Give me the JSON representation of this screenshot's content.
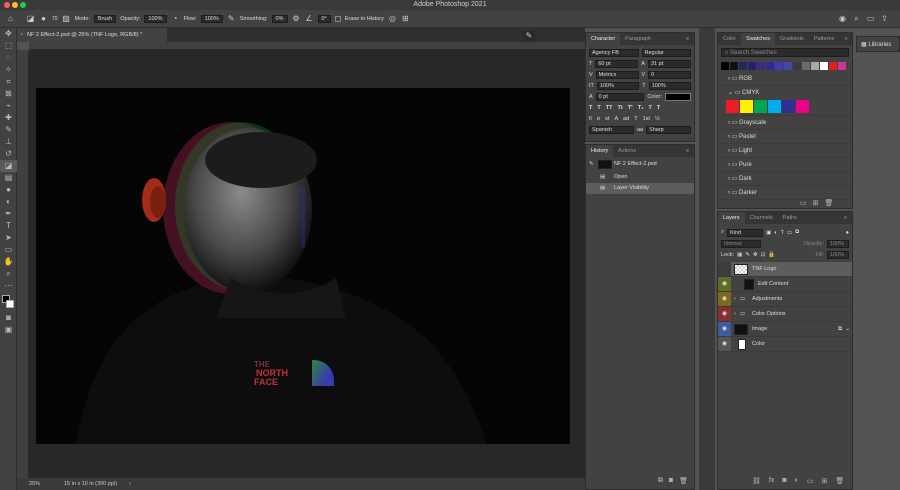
{
  "app": {
    "title": "Adobe Photoshop 2021"
  },
  "options_bar": {
    "brush_size": "70",
    "mode_label": "Mode:",
    "mode_value": "Brush",
    "opacity_label": "Opacity:",
    "opacity_value": "100%",
    "flow_label": "Flow:",
    "flow_value": "100%",
    "smoothing_label": "Smoothing:",
    "smoothing_value": "0%",
    "angle_value": "0°",
    "erase_history_label": "Erase to History"
  },
  "document": {
    "tab_title": "NF 2 Effect-2.psd @ 25% (TNF Logo, RGB/8) *",
    "zoom": "25%",
    "doc_size": "15 in x 10 in (300 ppi)",
    "logo_text": [
      "THE",
      "NORTH",
      "FACE"
    ]
  },
  "character_panel": {
    "tabs": [
      "Character",
      "Paragraph"
    ],
    "font_family": "Agency FB",
    "font_style": "Regular",
    "font_size": "60 pt",
    "leading": "31 pt",
    "kerning": "Metrics",
    "tracking": "0",
    "vscale": "100%",
    "hscale": "100%",
    "baseline": "0 pt",
    "color_label": "Color:",
    "language": "Spanish",
    "antialias": "Sharp",
    "style_buttons": [
      "T",
      "T",
      "TT",
      "Tt",
      "T¹",
      "T₁",
      "T",
      "T"
    ],
    "ligature_buttons": [
      "fi",
      "σ",
      "st",
      "A",
      "ad",
      "T",
      "1st",
      "½"
    ]
  },
  "history_panel": {
    "tabs": [
      "History",
      "Actions"
    ],
    "snapshot": "NF 2 Effect-2.psd",
    "steps": [
      "Open",
      "Layer Visibility"
    ]
  },
  "swatches_panel": {
    "tabs": [
      "Color",
      "Swatches",
      "Gradients",
      "Patterns"
    ],
    "search_placeholder": "Search Swatches",
    "recent_colors": [
      "#000000",
      "#111111",
      "#1d2a5a",
      "#24206a",
      "#3a2d7a",
      "#302a9c",
      "#3c3cb4",
      "#4646aa",
      "#3a3a3a",
      "#6a6a6a",
      "#a8a8a8",
      "#ffffff",
      "#e02020",
      "#cc3399"
    ],
    "groups": [
      "RGB",
      "CMYK",
      "Grayscale",
      "Pastel",
      "Light",
      "Pure",
      "Dark",
      "Darker"
    ],
    "cmyk_colors": [
      "#ee1c24",
      "#fff200",
      "#00a651",
      "#00aeef",
      "#2e3192",
      "#ec008c"
    ]
  },
  "layers_panel": {
    "tabs": [
      "Layers",
      "Channels",
      "Paths"
    ],
    "filter_kind": "Kind",
    "blend_mode": "Normal",
    "opacity_label": "Opacity:",
    "opacity_value": "100%",
    "lock_label": "Lock:",
    "fill_label": "Fill:",
    "fill_value": "100%",
    "layers": [
      {
        "name": "TNF Logo",
        "visible": false,
        "color": "#555555"
      },
      {
        "name": "Edit Content",
        "visible": true,
        "color": "#5a6e2a"
      },
      {
        "name": "Adjustments",
        "visible": true,
        "color": "#7a6a1a"
      },
      {
        "name": "Color Options",
        "visible": true,
        "color": "#8a2f2f"
      },
      {
        "name": "Image",
        "visible": true,
        "color": "#3b5d9e"
      },
      {
        "name": "Color",
        "visible": true,
        "color": "#555555"
      }
    ]
  },
  "libraries": {
    "label": "Libraries"
  },
  "colors": {
    "ui_dark": "#424242",
    "panel_header": "#353535",
    "selection": "#5d5d5d"
  }
}
